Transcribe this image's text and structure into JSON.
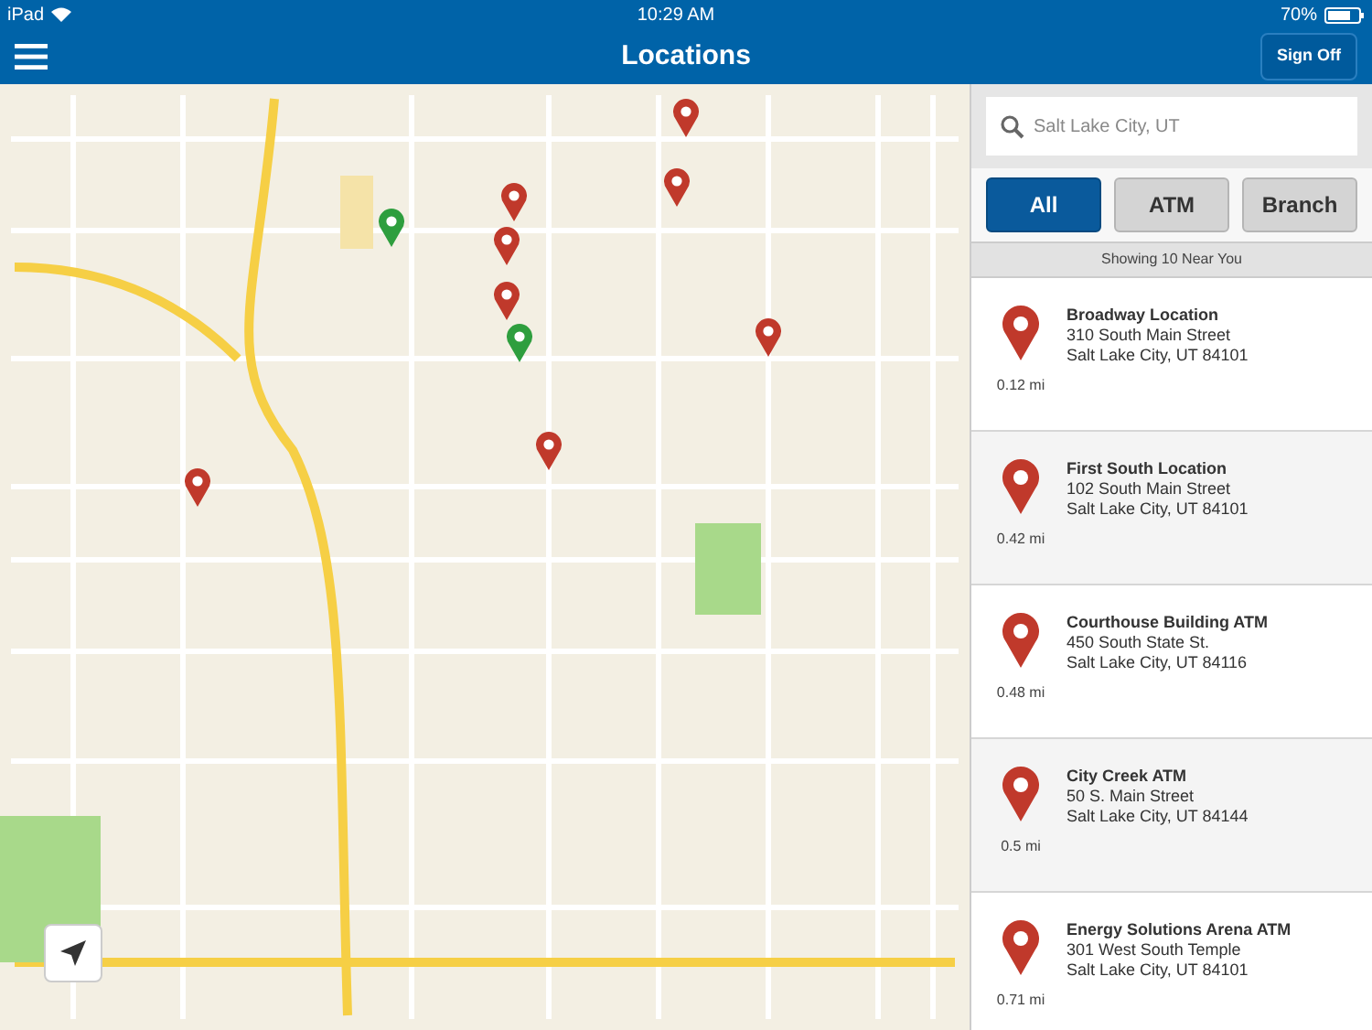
{
  "status_bar": {
    "device": "iPad",
    "time": "10:29 AM",
    "battery": "70%"
  },
  "nav_bar": {
    "title": "Locations",
    "button": "Sign Off"
  },
  "search": {
    "value": "Salt Lake City, UT"
  },
  "filters": [
    {
      "label": "All",
      "selected": true
    },
    {
      "label": "ATM",
      "selected": false
    },
    {
      "label": "Branch",
      "selected": false
    }
  ],
  "results_header": "Showing 10 Near You",
  "locations": [
    {
      "name": "Broadway Location",
      "address": "310 South Main Street",
      "city": "Salt Lake City, UT 84101",
      "distance": "0.12 mi"
    },
    {
      "name": "First South Location",
      "address": "102 South Main Street",
      "city": "Salt Lake City, UT 84101",
      "distance": "0.42 mi"
    },
    {
      "name": "Courthouse Building ATM",
      "address": "450 South State St.",
      "city": "Salt Lake City, UT 84116",
      "distance": "0.48 mi"
    },
    {
      "name": "City Creek ATM",
      "address": "50 S. Main Street",
      "city": "Salt Lake City, UT 84144",
      "distance": "0.5 mi"
    },
    {
      "name": "Energy Solutions Arena ATM",
      "address": "301 West South Temple",
      "city": "Salt Lake City, UT 84101",
      "distance": "0.71 mi"
    }
  ]
}
